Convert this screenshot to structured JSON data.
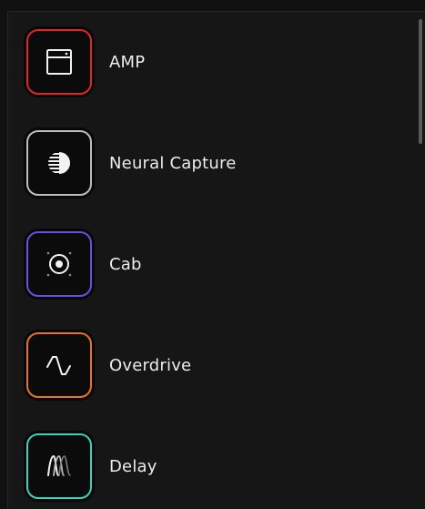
{
  "blocks": [
    {
      "label": "AMP",
      "icon": "amp-icon",
      "accent": "#e0262b"
    },
    {
      "label": "Neural Capture",
      "icon": "neural-capture-icon",
      "accent": "#bdbdbd"
    },
    {
      "label": "Cab",
      "icon": "cab-speaker-icon",
      "accent": "#6a4fe0"
    },
    {
      "label": "Overdrive",
      "icon": "overdrive-wave-icon",
      "accent": "#e9741e"
    },
    {
      "label": "Delay",
      "icon": "delay-wave-icon",
      "accent": "#38d3b9"
    }
  ]
}
